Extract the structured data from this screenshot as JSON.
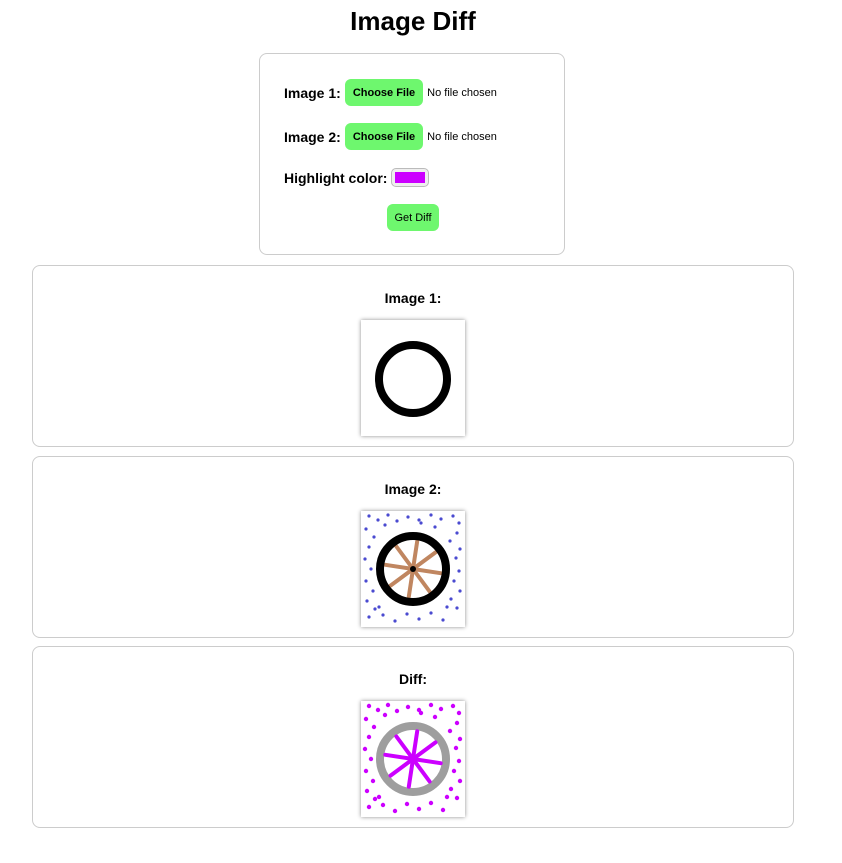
{
  "page": {
    "title": "Image Diff"
  },
  "form": {
    "image1_label": "Image 1:",
    "image2_label": "Image 2:",
    "choose_file_label": "Choose File",
    "no_file_text": "No file chosen",
    "highlight_label": "Highlight color:",
    "highlight_color": "#cc00ff",
    "get_diff_label": "Get Diff"
  },
  "panels": [
    {
      "label": "Image 1:"
    },
    {
      "label": "Image 2:"
    },
    {
      "label": "Diff:"
    }
  ],
  "colors": {
    "button_green": "#6ef76e",
    "border_gray": "#cccccc",
    "spoke_brown": "#c08660",
    "dot_blue": "#4a4ad0",
    "diff_gray": "#9e9e9e"
  }
}
